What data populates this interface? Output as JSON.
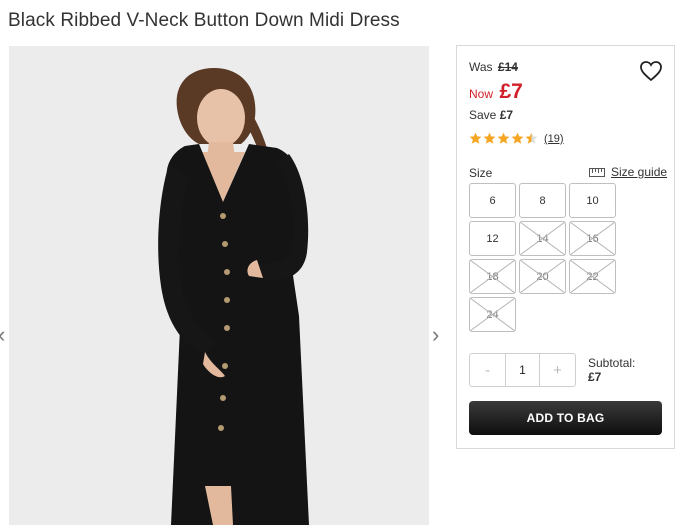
{
  "product": {
    "title": "Black Ribbed V-Neck Button Down Midi Dress"
  },
  "gallery": {
    "prev_arrow": "‹",
    "next_arrow": "›"
  },
  "price": {
    "was_label": "Was",
    "was_value": "£14",
    "now_label": "Now",
    "now_value": "£7",
    "save_label": "Save",
    "save_value": "£7",
    "sale_color": "#d11f2a"
  },
  "rating": {
    "stars": 4.5,
    "max_stars": 5,
    "count": "(19)",
    "star_color": "#f5a623"
  },
  "size": {
    "label": "Size",
    "guide_label": "Size guide",
    "guide_icon": "ruler-icon",
    "options": [
      {
        "label": "6",
        "available": true
      },
      {
        "label": "8",
        "available": true
      },
      {
        "label": "10",
        "available": true
      },
      {
        "label": "12",
        "available": true
      },
      {
        "label": "14",
        "available": false
      },
      {
        "label": "16",
        "available": false
      },
      {
        "label": "18",
        "available": false
      },
      {
        "label": "20",
        "available": false
      },
      {
        "label": "22",
        "available": false
      },
      {
        "label": "24",
        "available": false
      }
    ]
  },
  "quantity": {
    "decrement": "-",
    "value": "1",
    "increment": "+"
  },
  "subtotal": {
    "label": "Subtotal:",
    "value": "£7"
  },
  "cart": {
    "add_label": "ADD TO BAG",
    "wishlist_icon": "heart-icon"
  }
}
